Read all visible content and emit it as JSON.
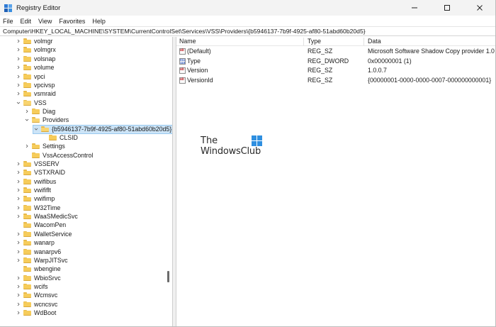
{
  "window": {
    "title": "Registry Editor",
    "controls": {
      "minimize": "minimize",
      "maximize": "maximize",
      "close": "close"
    }
  },
  "menu": {
    "items": [
      "File",
      "Edit",
      "View",
      "Favorites",
      "Help"
    ]
  },
  "address": {
    "path": "Computer\\HKEY_LOCAL_MACHINE\\SYSTEM\\CurrentControlSet\\Services\\VSS\\Providers\\{b5946137-7b9f-4925-af80-51abd60b20d5}"
  },
  "tree": {
    "items": [
      {
        "label": "volmgr",
        "level": 0,
        "expander": "collapsed"
      },
      {
        "label": "volmgrx",
        "level": 0,
        "expander": "collapsed"
      },
      {
        "label": "volsnap",
        "level": 0,
        "expander": "collapsed"
      },
      {
        "label": "volume",
        "level": 0,
        "expander": "collapsed"
      },
      {
        "label": "vpci",
        "level": 0,
        "expander": "collapsed"
      },
      {
        "label": "vpcivsp",
        "level": 0,
        "expander": "collapsed"
      },
      {
        "label": "vsmraid",
        "level": 0,
        "expander": "collapsed"
      },
      {
        "label": "VSS",
        "level": 0,
        "expander": "expanded"
      },
      {
        "label": "Diag",
        "level": 1,
        "expander": "collapsed"
      },
      {
        "label": "Providers",
        "level": 1,
        "expander": "expanded"
      },
      {
        "label": "{b5946137-7b9f-4925-af80-51abd60b20d5}",
        "level": 2,
        "expander": "expanded",
        "selected": true
      },
      {
        "label": "CLSID",
        "level": 3,
        "expander": "none"
      },
      {
        "label": "Settings",
        "level": 1,
        "expander": "collapsed"
      },
      {
        "label": "VssAccessControl",
        "level": 1,
        "expander": "none"
      },
      {
        "label": "VSSERV",
        "level": 0,
        "expander": "collapsed"
      },
      {
        "label": "VSTXRAID",
        "level": 0,
        "expander": "collapsed"
      },
      {
        "label": "vwifibus",
        "level": 0,
        "expander": "collapsed"
      },
      {
        "label": "vwififlt",
        "level": 0,
        "expander": "collapsed"
      },
      {
        "label": "vwifimp",
        "level": 0,
        "expander": "collapsed"
      },
      {
        "label": "W32Time",
        "level": 0,
        "expander": "collapsed"
      },
      {
        "label": "WaaSMedicSvc",
        "level": 0,
        "expander": "collapsed"
      },
      {
        "label": "WacomPen",
        "level": 0,
        "expander": "none"
      },
      {
        "label": "WalletService",
        "level": 0,
        "expander": "collapsed"
      },
      {
        "label": "wanarp",
        "level": 0,
        "expander": "collapsed"
      },
      {
        "label": "wanarpv6",
        "level": 0,
        "expander": "collapsed"
      },
      {
        "label": "WarpJITSvc",
        "level": 0,
        "expander": "collapsed"
      },
      {
        "label": "wbengine",
        "level": 0,
        "expander": "none"
      },
      {
        "label": "WbioSrvc",
        "level": 0,
        "expander": "collapsed"
      },
      {
        "label": "wcifs",
        "level": 0,
        "expander": "collapsed"
      },
      {
        "label": "Wcmsvc",
        "level": 0,
        "expander": "collapsed"
      },
      {
        "label": "wcncsvc",
        "level": 0,
        "expander": "collapsed"
      },
      {
        "label": "WdBoot",
        "level": 0,
        "expander": "collapsed"
      }
    ]
  },
  "values": {
    "columns": {
      "name": "Name",
      "type": "Type",
      "data": "Data"
    },
    "rows": [
      {
        "name": "(Default)",
        "type": "REG_SZ",
        "data": "Microsoft Software Shadow Copy provider 1.0",
        "icon": "string-value-icon"
      },
      {
        "name": "Type",
        "type": "REG_DWORD",
        "data": "0x00000001 (1)",
        "icon": "binary-value-icon"
      },
      {
        "name": "Version",
        "type": "REG_SZ",
        "data": "1.0.0.7",
        "icon": "string-value-icon"
      },
      {
        "name": "VersionId",
        "type": "REG_SZ",
        "data": "{00000001-0000-0000-0007-000000000001}",
        "icon": "string-value-icon"
      }
    ]
  },
  "watermark": {
    "line1": "The",
    "line2": "WindowsClub"
  }
}
